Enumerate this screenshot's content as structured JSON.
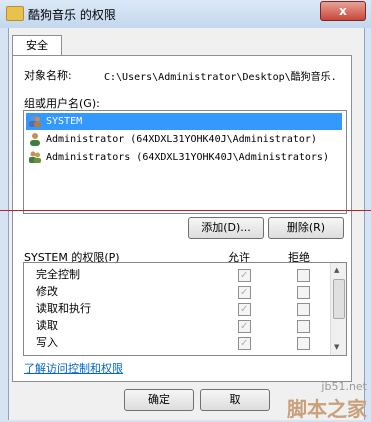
{
  "window": {
    "title": "酷狗音乐 的权限",
    "close_label": "x"
  },
  "tabs": [
    {
      "label": "安全"
    }
  ],
  "object": {
    "label": "对象名称:",
    "value": "C:\\Users\\Administrator\\Desktop\\酷狗音乐."
  },
  "groups": {
    "label": "组或用户名(G):",
    "items": [
      {
        "name": "SYSTEM",
        "icon": "user-group-icon",
        "selected": true
      },
      {
        "name": "Administrator (64XDXL31YOHK40J\\Administrator)",
        "icon": "user-icon",
        "selected": false
      },
      {
        "name": "Administrators (64XDXL31YOHK40J\\Administrators)",
        "icon": "user-group-icon",
        "selected": false
      }
    ]
  },
  "buttons": {
    "add": "添加(D)...",
    "remove": "删除(R)",
    "ok": "确定",
    "cancel": "取"
  },
  "permissions": {
    "label": "SYSTEM 的权限(P)",
    "allow_header": "允许",
    "deny_header": "拒绝",
    "rows": [
      {
        "name": "完全控制",
        "allow": true,
        "deny": false
      },
      {
        "name": "修改",
        "allow": true,
        "deny": false
      },
      {
        "name": "读取和执行",
        "allow": true,
        "deny": false
      },
      {
        "name": "读取",
        "allow": true,
        "deny": false
      },
      {
        "name": "写入",
        "allow": true,
        "deny": false
      }
    ]
  },
  "link": {
    "label": "了解访问控制和权限"
  },
  "watermark": {
    "site": "jb51.net",
    "brand": "脚本之家"
  },
  "colors": {
    "selection": "#3399ff",
    "link": "#0066cc",
    "close": "#c8473a"
  }
}
